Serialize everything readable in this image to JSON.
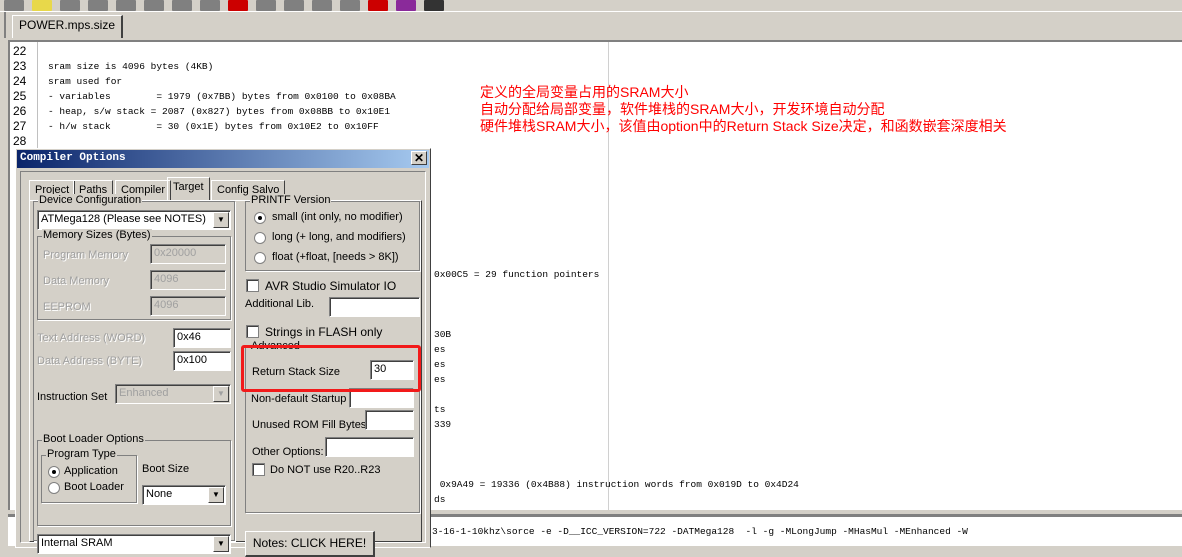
{
  "file_tab": "POWER.mps.size",
  "editor": {
    "lines": [
      {
        "n": "22",
        "text": ""
      },
      {
        "n": "23",
        "text": "sram size is 4096 bytes (4KB)"
      },
      {
        "n": "24",
        "text": "sram used for"
      },
      {
        "n": "25",
        "text": "- variables        = 1979 (0x7BB) bytes from 0x0100 to 0x08BA"
      },
      {
        "n": "26",
        "text": "- heap, s/w stack = 2087 (0x827) bytes from 0x08BB to 0x10E1"
      },
      {
        "n": "27",
        "text": "- h/w stack        = 30 (0x1E) bytes from 0x10E2 to 0x10FF"
      },
      {
        "n": "28",
        "text": ""
      }
    ],
    "fragments": [
      "0x00C5 = 29 function pointers",
      "30B",
      "es",
      "es",
      "es",
      "ts",
      "339",
      " 0x9A49 = 19336 (0x4B88) instruction words from 0x019D to 0x4D24",
      "ds"
    ]
  },
  "annotations": [
    "定义的全局变量占用的SRAM大小",
    "自动分配给局部变量，软件堆栈的SRAM大小，开发环境自动分配",
    "硬件堆栈SRAM大小，该值由option中的Return Stack Size决定，和函数嵌套深度相关"
  ],
  "output": [
    "3-16-1-10khz\\sorce -e -D__ICC_VERSION=722 -DATMega128  -l -g -MLongJump -MHasMul -MEnhanced -W"
  ],
  "dialog": {
    "title": "Compiler Options",
    "tabs": [
      "Project",
      "Paths",
      "Compiler",
      "Target",
      "Config Salvo"
    ],
    "active_tab": "Target",
    "device_config_label": "Device Configuration",
    "device": "ATMega128 (Please see NOTES)",
    "memory_label": "Memory Sizes (Bytes)",
    "program_memory_label": "Program Memory",
    "program_memory": "0x20000",
    "data_memory_label": "Data Memory",
    "data_memory": "4096",
    "eeprom_label": "EEPROM",
    "eeprom": "4096",
    "text_address_label": "Text Address (WORD)",
    "text_address": "0x46",
    "data_address_label": "Data Address (BYTE)",
    "data_address": "0x100",
    "instruction_set_label": "Instruction Set",
    "instruction_set": "Enhanced",
    "boot_loader_label": "Boot Loader Options",
    "program_type_label": "Program Type",
    "program_types": [
      "Application",
      "Boot Loader"
    ],
    "program_type_selected": "Application",
    "boot_size_label": "Boot Size",
    "boot_size": "None",
    "memory_type": "Internal SRAM",
    "printf_label": "PRINTF Version",
    "printf_options": [
      "small (int only, no modifier)",
      "long (+ long, and modifiers)",
      "float (+float, [needs > 8K])"
    ],
    "printf_selected": "small (int only, no modifier)",
    "avr_sim_label": "AVR Studio Simulator IO",
    "avr_sim_checked": false,
    "additional_lib_label": "Additional Lib.",
    "additional_lib": "",
    "strings_flash_label": "Strings in FLASH only",
    "strings_flash_checked": false,
    "advanced_label": "Advanced",
    "return_stack_label": "Return Stack Size",
    "return_stack": "30",
    "nondefault_startup_label": "Non-default Startup",
    "nondefault_startup": "",
    "unused_rom_label": "Unused ROM Fill Bytes",
    "unused_rom": "",
    "other_options_label": "Other Options:",
    "other_options": "",
    "no_r20_label": "Do NOT use R20..R23",
    "no_r20_checked": false,
    "notes_button": "Notes: CLICK HERE!"
  },
  "colors": {
    "annotation": "#ff0000",
    "highlight_box": "#f21a1a",
    "title_bar": "#0a246a"
  }
}
